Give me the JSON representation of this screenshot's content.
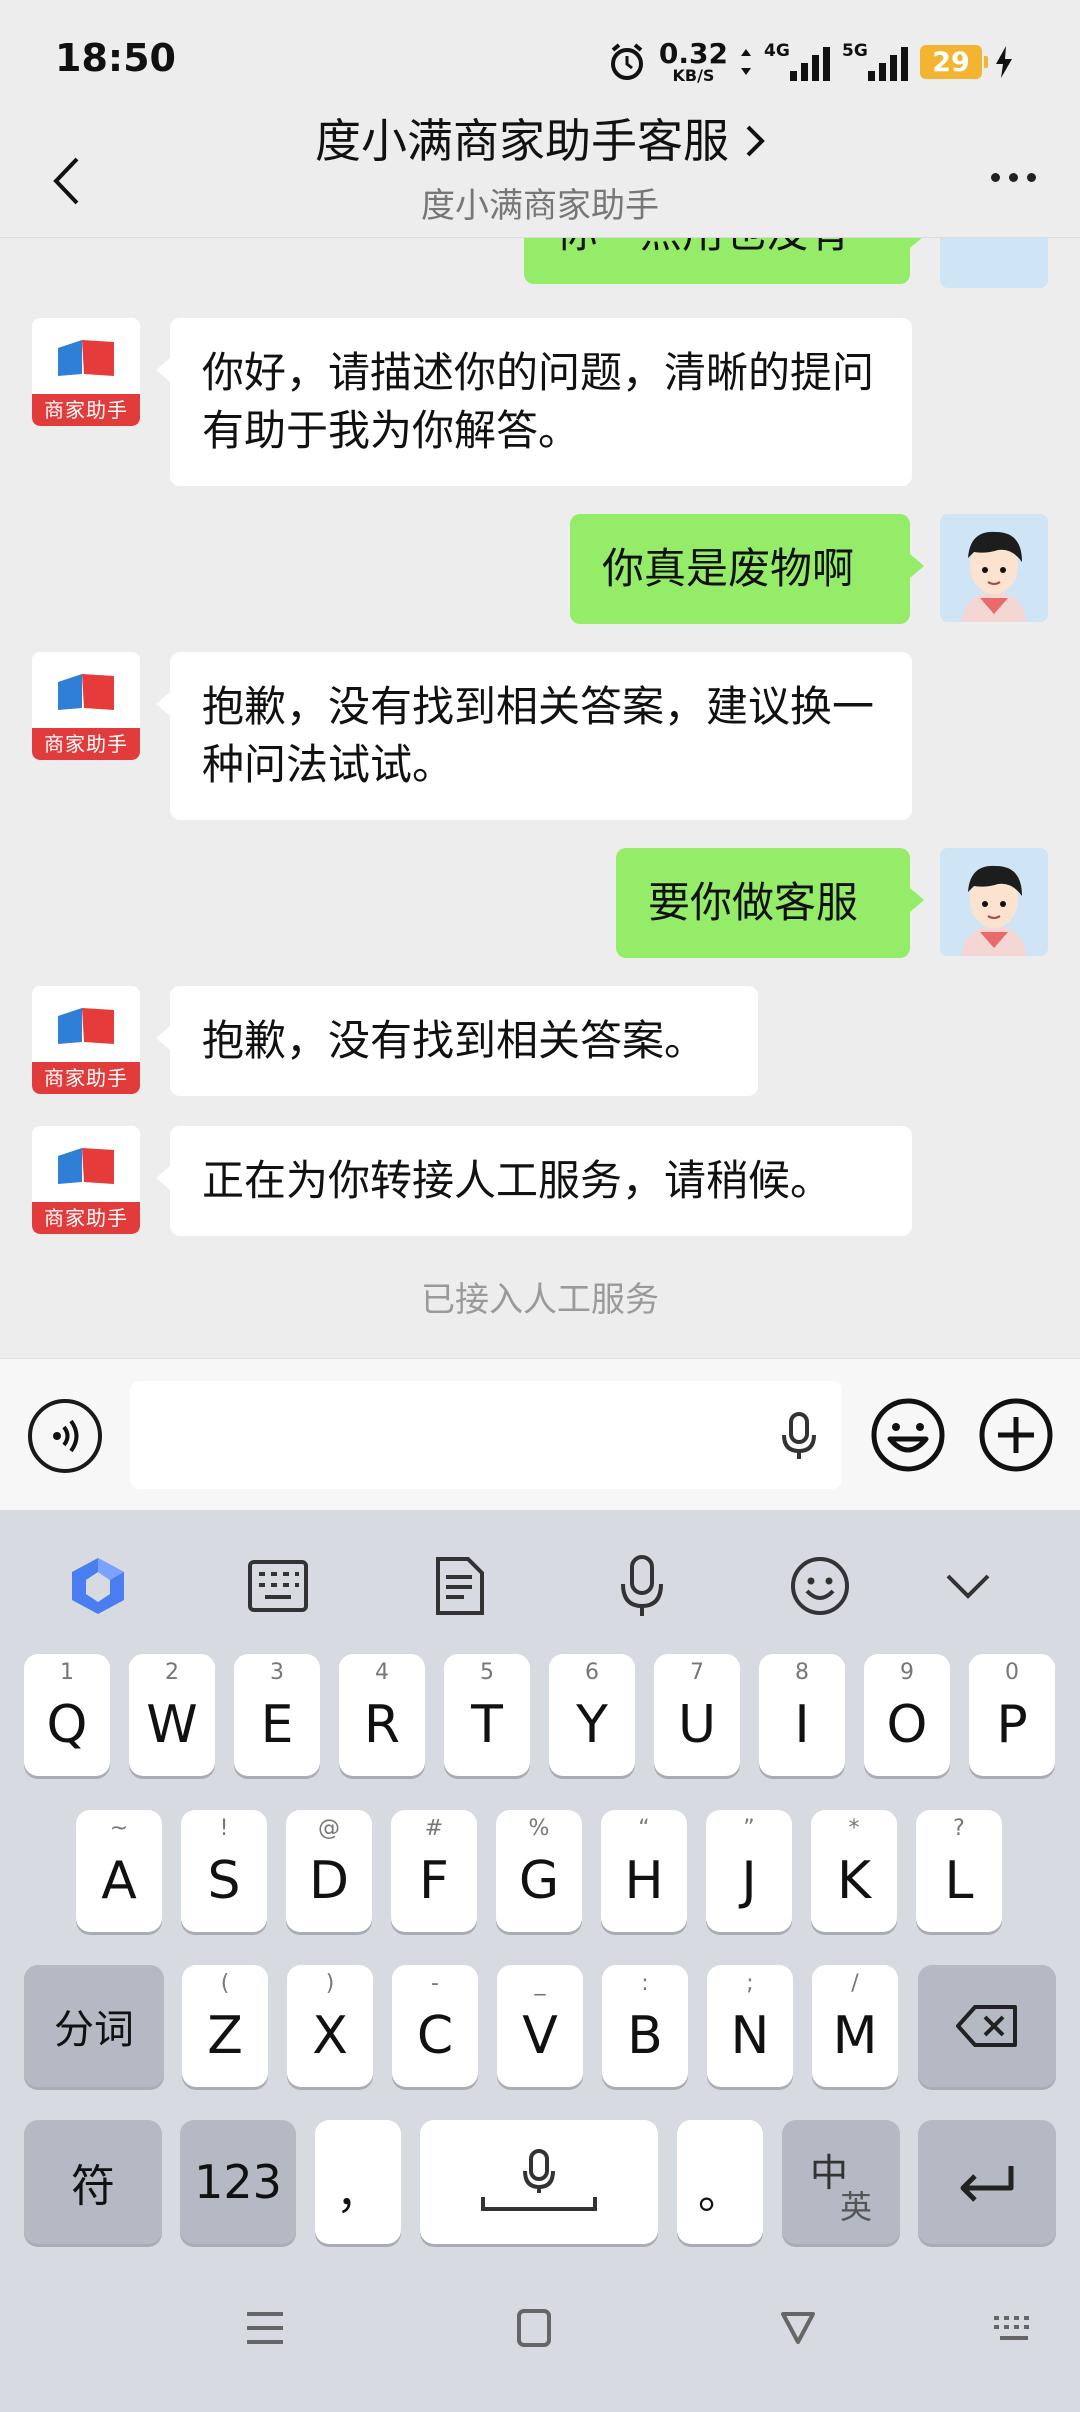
{
  "status_bar": {
    "time": "18:50",
    "net_speed": "0.32",
    "net_unit": "KB/S",
    "sig1_label": "4G",
    "sig2_label": "5G",
    "battery": "29"
  },
  "header": {
    "title": "度小满商家助手客服",
    "subtitle": "度小满商家助手"
  },
  "chat": {
    "bot_tag": "商家助手",
    "partial_top": "你一点用也没有",
    "messages": [
      {
        "side": "left",
        "text": "你好，请描述你的问题，清晰的提问有助于我为你解答。"
      },
      {
        "side": "right",
        "text": "你真是废物啊"
      },
      {
        "side": "left",
        "text": "抱歉，没有找到相关答案，建议换一种问法试试。"
      },
      {
        "side": "right",
        "text": "要你做客服"
      },
      {
        "side": "left",
        "text": "抱歉，没有找到相关答案。"
      },
      {
        "side": "left",
        "text": "正在为你转接人工服务，请稍候。"
      }
    ],
    "system_note": "已接入人工服务"
  },
  "input": {
    "value": "",
    "placeholder": ""
  },
  "keyboard": {
    "row1": [
      {
        "hint": "1",
        "key": "Q"
      },
      {
        "hint": "2",
        "key": "W"
      },
      {
        "hint": "3",
        "key": "E"
      },
      {
        "hint": "4",
        "key": "R"
      },
      {
        "hint": "5",
        "key": "T"
      },
      {
        "hint": "6",
        "key": "Y"
      },
      {
        "hint": "7",
        "key": "U"
      },
      {
        "hint": "8",
        "key": "I"
      },
      {
        "hint": "9",
        "key": "O"
      },
      {
        "hint": "0",
        "key": "P"
      }
    ],
    "row2": [
      {
        "hint": "~",
        "key": "A"
      },
      {
        "hint": "!",
        "key": "S"
      },
      {
        "hint": "@",
        "key": "D"
      },
      {
        "hint": "#",
        "key": "F"
      },
      {
        "hint": "%",
        "key": "G"
      },
      {
        "hint": "“",
        "key": "H"
      },
      {
        "hint": "”",
        "key": "J"
      },
      {
        "hint": "*",
        "key": "K"
      },
      {
        "hint": "?",
        "key": "L"
      }
    ],
    "row3": [
      {
        "hint": "(",
        "key": "Z"
      },
      {
        "hint": ")",
        "key": "X"
      },
      {
        "hint": "-",
        "key": "C"
      },
      {
        "hint": "_",
        "key": "V"
      },
      {
        "hint": ":",
        "key": "B"
      },
      {
        "hint": ";",
        "key": "N"
      },
      {
        "hint": "/",
        "key": "M"
      }
    ],
    "segment_label": "分词",
    "symbol_label": "符",
    "numeric_label": "123",
    "comma_label": "，",
    "period_label": "。",
    "lang_primary": "中",
    "lang_secondary": "英"
  },
  "icons": {
    "back": "back-chevron-icon",
    "more": "more-dots-icon",
    "voice": "voice-icon",
    "mic": "mic-icon",
    "emoji": "emoji-icon",
    "plus": "plus-icon",
    "assistant": "assistant-logo-icon",
    "keyboard": "keyboard-icon",
    "clipboard": "clipboard-icon",
    "collapse": "chevron-down-icon",
    "backspace": "backspace-icon",
    "enter": "enter-icon"
  },
  "colors": {
    "user_bubble": "#95ec69",
    "bot_bubble": "#ffffff",
    "background": "#ededed",
    "keyboard_bg": "#d7dae1",
    "battery": "#f2b431",
    "bot_tag": "#e23b3b"
  }
}
